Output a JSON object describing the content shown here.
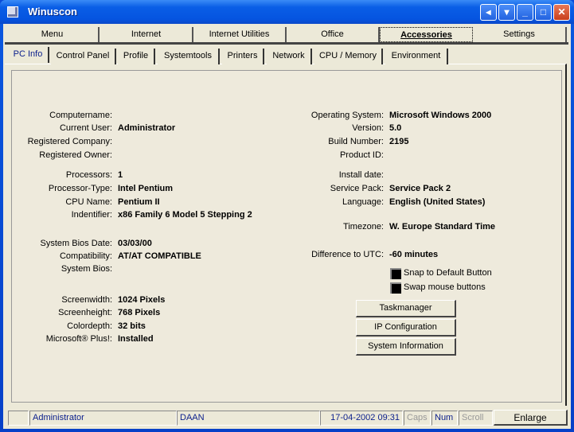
{
  "window": {
    "title": "Winuscon"
  },
  "menu": [
    "Menu",
    "Internet",
    "Internet Utilities",
    "Office",
    "Accessories",
    "Settings"
  ],
  "tabs": [
    "PC Info",
    "Control Panel",
    "Profile",
    "Systemtools",
    "Printers",
    "Network",
    "CPU / Memory",
    "Environment"
  ],
  "left": [
    {
      "label": "Computername:",
      "value": ""
    },
    {
      "label": "Current User:",
      "value": "Administrator"
    },
    {
      "label": "Registered Company:",
      "value": ""
    },
    {
      "label": "Registered Owner:",
      "value": ""
    },
    {
      "label": "Processors:",
      "value": "1"
    },
    {
      "label": "Processor-Type:",
      "value": "Intel Pentium"
    },
    {
      "label": "CPU Name:",
      "value": "Pentium II"
    },
    {
      "label": "Indentifier:",
      "value": "x86 Family 6 Model 5 Stepping 2"
    },
    {
      "label": "System Bios Date:",
      "value": "03/03/00"
    },
    {
      "label": "Compatibility:",
      "value": "AT/AT COMPATIBLE"
    },
    {
      "label": "System Bios:",
      "value": ""
    },
    {
      "label": "Screenwidth:",
      "value": "1024 Pixels"
    },
    {
      "label": "Screenheight:",
      "value": "768 Pixels"
    },
    {
      "label": "Colordepth:",
      "value": "32 bits"
    },
    {
      "label": "Microsoft® Plus!:",
      "value": "Installed"
    }
  ],
  "right": [
    {
      "label": "Operating System:",
      "value": "Microsoft Windows 2000"
    },
    {
      "label": "Version:",
      "value": "5.0"
    },
    {
      "label": "Build Number:",
      "value": "2195"
    },
    {
      "label": "Product ID:",
      "value": ""
    },
    {
      "label": "Install date:",
      "value": ""
    },
    {
      "label": "Service Pack:",
      "value": "Service Pack 2"
    },
    {
      "label": "Language:",
      "value": "English (United States)"
    },
    {
      "label": "Timezone:",
      "value": "W. Europe Standard Time"
    },
    {
      "label": "Difference to UTC:",
      "value": "-60 minutes"
    }
  ],
  "checkboxes": [
    "Snap to Default Button",
    "Swap mouse buttons"
  ],
  "buttons": [
    "Taskmanager",
    "IP Configuration",
    "System Information"
  ],
  "status": {
    "user": "Administrator",
    "computer": "DAAN",
    "datetime": "17-04-2002 09:31",
    "caps": "Caps",
    "num": "Num",
    "scroll": "Scroll",
    "enlarge": "Enlarge"
  }
}
